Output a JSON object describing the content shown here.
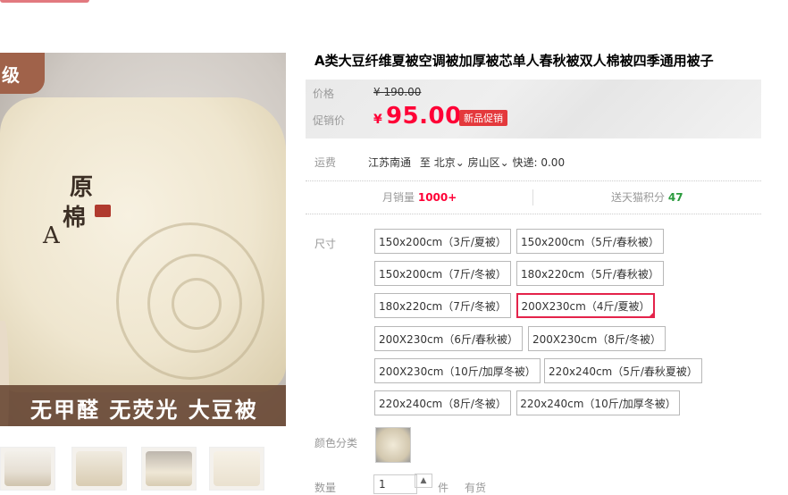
{
  "product": {
    "title": "A类大豆纤维夏被空调被加厚被芯单人春秋被双人棉被四季通用被子",
    "image_badge": "级",
    "image_banner": "无甲醛 无荧光 大豆被",
    "stamp_chars": [
      "原",
      "棉",
      "A"
    ]
  },
  "price": {
    "label": "价格",
    "original": "¥ 190.00",
    "promo_label": "促销价",
    "currency": "¥",
    "promo_value": "95.00",
    "promo_tag": "新品促销"
  },
  "shipping": {
    "label": "运费",
    "origin": "江苏南通",
    "to": "至",
    "city": "北京",
    "district": "房山区",
    "fee": "快递: 0.00"
  },
  "stats": {
    "monthly_sales_label": "月销量",
    "monthly_sales_value": "1000+",
    "points_label": "送天猫积分",
    "points_value": "47"
  },
  "size": {
    "label": "尺寸",
    "selected_index": 5,
    "options": [
      "150x200cm（3斤/夏被）",
      "150x200cm（5斤/春秋被）",
      "150x200cm（7斤/冬被）",
      "180x220cm（5斤/春秋被）",
      "180x220cm（7斤/冬被）",
      "200X230cm（4斤/夏被）",
      "200X230cm（6斤/春秋被）",
      "200X230cm（8斤/冬被）",
      "200X230cm（10斤/加厚冬被）",
      "220x240cm（5斤/春秋夏被）",
      "220x240cm（8斤/冬被）",
      "220x240cm（10斤/加厚冬被）"
    ]
  },
  "color": {
    "label": "颜色分类"
  },
  "quantity": {
    "label": "数量",
    "value": "1",
    "unit": "件",
    "stock": "有货"
  },
  "colors": {
    "accent_red": "#ff0036",
    "selected_border": "#e4234a",
    "banner_brown": "#694834"
  }
}
